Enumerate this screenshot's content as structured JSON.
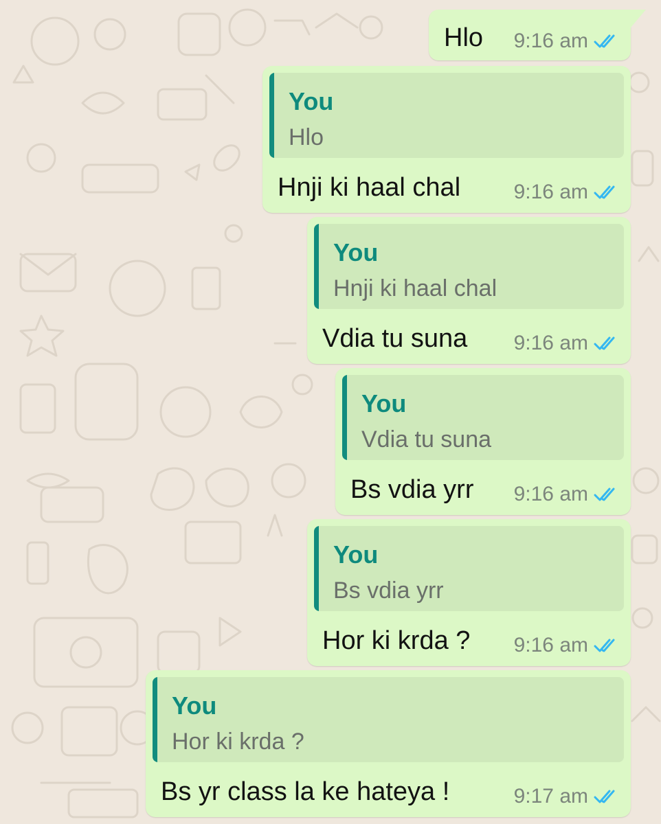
{
  "colors": {
    "wallpaper": "#efe7dd",
    "outgoing_bubble": "#dcf8c6",
    "quote_background": "#cfe9bb",
    "quote_accent": "#128c7e",
    "read_ticks": "#34b7f1"
  },
  "messages": [
    {
      "text": "Hlo",
      "time": "9:16 am",
      "status_icon": "double-check-read-icon"
    },
    {
      "reply_to": {
        "author": "You",
        "text": "Hlo"
      },
      "text": "Hnji ki haal chal",
      "time": "9:16 am",
      "status_icon": "double-check-read-icon"
    },
    {
      "reply_to": {
        "author": "You",
        "text": "Hnji ki haal chal"
      },
      "text": "Vdia tu suna",
      "time": "9:16 am",
      "status_icon": "double-check-read-icon"
    },
    {
      "reply_to": {
        "author": "You",
        "text": "Vdia tu suna"
      },
      "text": "Bs vdia yrr",
      "time": "9:16 am",
      "status_icon": "double-check-read-icon"
    },
    {
      "reply_to": {
        "author": "You",
        "text": "Bs vdia yrr"
      },
      "text": "Hor ki krda ?",
      "time": "9:16 am",
      "status_icon": "double-check-read-icon"
    },
    {
      "reply_to": {
        "author": "You",
        "text": "Hor ki krda ?"
      },
      "text": "Bs yr class la ke hateya !",
      "time": "9:17 am",
      "status_icon": "double-check-read-icon"
    }
  ]
}
